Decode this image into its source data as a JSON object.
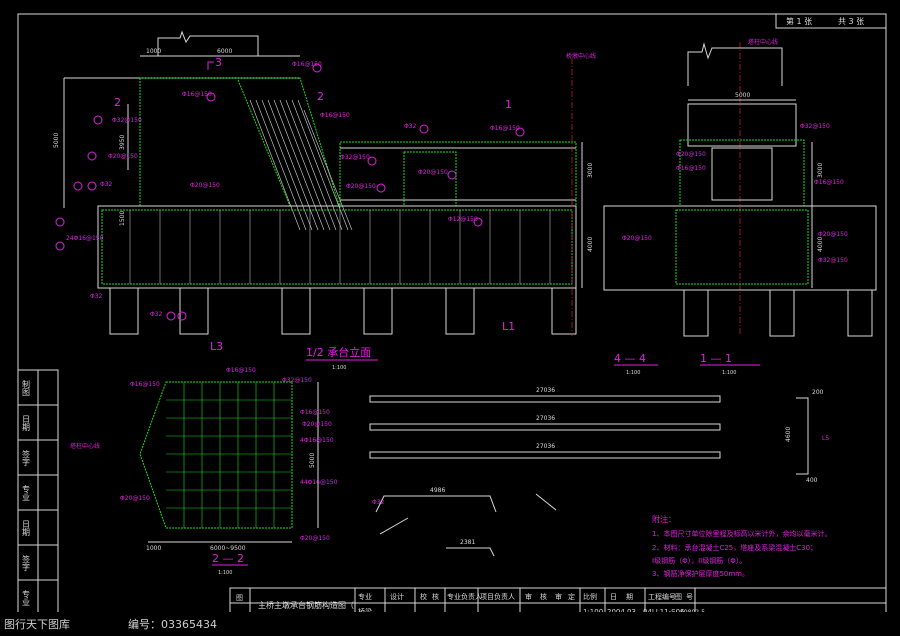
{
  "sheet": {
    "header_sheet": "第 1 张",
    "header_total": "共 3 张",
    "drawing_title": "主桥主墩承台钢筋构造图（",
    "project_type": "专业",
    "project_name": "桥梁",
    "scale": "1:100",
    "date": "2004.03",
    "code": "04LL11-S06",
    "sheet_no": "19802-5"
  },
  "title_block": {
    "labels": [
      "设计",
      "校",
      "核",
      "专业负责人",
      "项目负责人",
      "审",
      "核",
      "审",
      "定",
      "比例",
      "日",
      "期",
      "工程编号",
      "图",
      "号"
    ]
  },
  "left_strip": {
    "labels": [
      "制图",
      "日期",
      "签字",
      "专业",
      "日期",
      "签字",
      "专业"
    ]
  },
  "views": {
    "elevation": {
      "title": "1/2 承台立面",
      "scale": "1:100"
    },
    "section_44": {
      "title": "4 — 4",
      "scale": "1:100"
    },
    "section_11": {
      "title": "1 — 1",
      "scale": "1:100"
    },
    "section_22": {
      "title": "2 — 2",
      "scale": "1:100"
    }
  },
  "section_marks": {
    "s3": "3",
    "s2a": "2",
    "s2b": "2",
    "s1": "1",
    "l1": "L1",
    "l3": "L3"
  },
  "axis_labels": {
    "bridge_center": "桥墩中心线",
    "tower_center": "塔柱中心线",
    "tower_center2": "塔柱中心线"
  },
  "dimensions": {
    "top_1000": "1000",
    "top_6000": "6000",
    "left_5000": "5000",
    "left_3950": "3950",
    "left_1500": "1500",
    "right_3000": "3000",
    "right_4000": "4000",
    "s11_5000": "5000",
    "s11_3000": "3000",
    "s11_4000": "4000",
    "s22_1000": "1000",
    "s22_6000": "6000~9500",
    "s22_5000": "5000",
    "bar_27036a": "27036",
    "bar_27036b": "27036",
    "bar_27036c": "27036",
    "bar_4986": "4986",
    "bar_2381": "2381",
    "stirrup_200": "200",
    "stirrup_4600": "4600",
    "stirrup_400": "400",
    "stirrup_l5": "L5"
  },
  "rebar_labels": {
    "r1": "Φ16@150",
    "r2": "Φ16@150",
    "r3": "Φ32@150",
    "r4": "Φ16@150",
    "r5": "Φ20@150",
    "r6": "Φ32",
    "r7": "Φ20@150",
    "r8": "Φ32@150",
    "r9": "Φ32",
    "r10": "Φ16@150",
    "r11": "Φ20@150",
    "r12": "24Φ16@150",
    "r13": "Φ32",
    "r14": "Φ32",
    "r15": "Φ20@150",
    "r16": "Φ12@150",
    "r17": "Φ16@150",
    "r18": "Φ16@150",
    "r19": "Φ32@150",
    "r20": "Φ16@150",
    "r21": "Φ20@150",
    "r22": "Φ20@150",
    "r23": "Φ16@150",
    "r24": "Φ20@150",
    "r25": "Φ32@150",
    "r26": "Φ20@150",
    "r27": "Φ16@150",
    "r28": "Φ16@150",
    "r29": "Φ20@150",
    "r30": "4Φ16@150",
    "r31": "44Φ16@150",
    "r32": "Φ32",
    "r33": "Φ20@150",
    "r34": "Φ32@150"
  },
  "notes": {
    "heading": "附注：",
    "lines": [
      "1、本图尺寸单位除里程及标高以米计外，余均以毫米计。",
      "2、材料：承台混凝土C25，塔座及系梁混凝土C30；",
      "   I级钢筋（Φ），II级钢筋（Φ）。",
      "3、钢筋净保护层厚度50mm。"
    ]
  },
  "watermark": {
    "left": "图行天下图库",
    "right": "编号：03365434"
  },
  "colors": {
    "line_white": "#d8d8d8",
    "green": "#18e018",
    "yellow": "#e8e800",
    "magenta": "#e020e0",
    "cyan": "#20e0e0",
    "red": "#e02020"
  }
}
